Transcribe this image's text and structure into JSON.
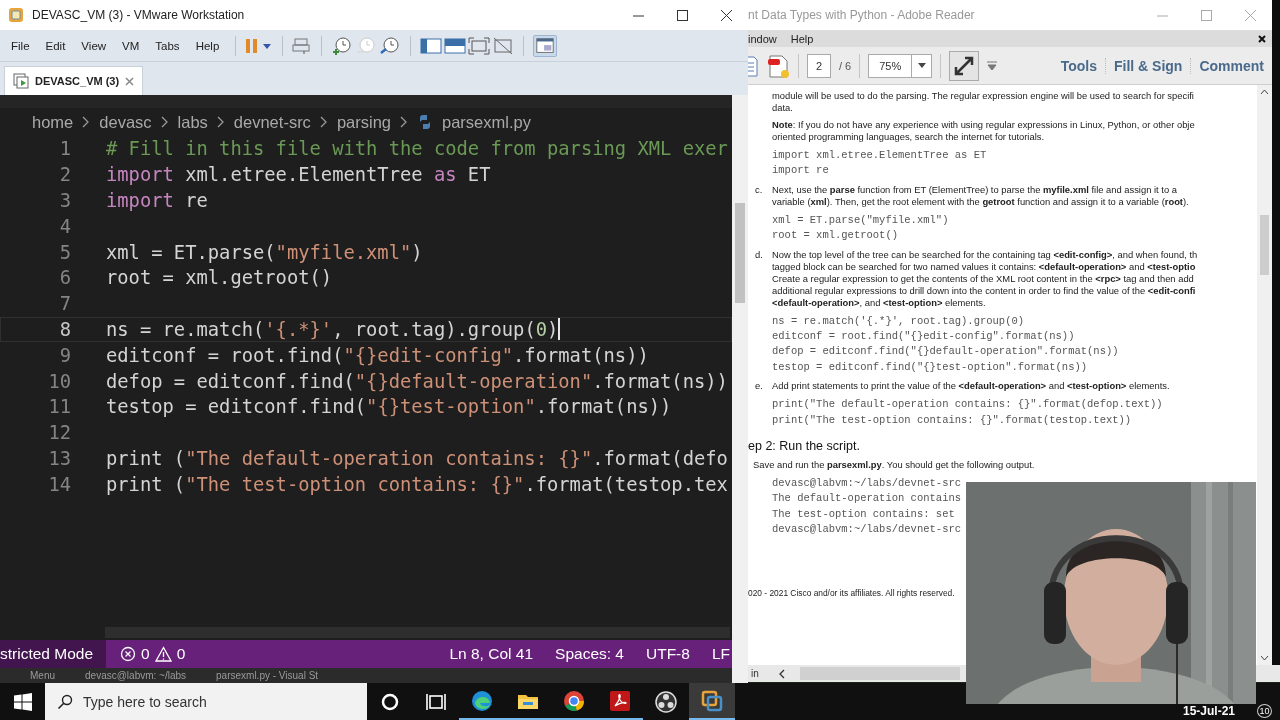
{
  "vmware": {
    "title": "DEVASC_VM (3) - VMware Workstation",
    "menu": [
      "File",
      "Edit",
      "View",
      "VM",
      "Tabs",
      "Help"
    ],
    "tabs": [
      {
        "label": "DEVASC_VM (3)",
        "selected": true
      }
    ],
    "editor": {
      "breadcrumbs": [
        "home",
        "devasc",
        "labs",
        "devnet-src",
        "parsing",
        "parsexml.py"
      ],
      "lines": [
        {
          "number": "1",
          "current": false,
          "tokens": [
            {
              "kind": "comment",
              "text": "# Fill in this file with the code from parsing XML exer"
            }
          ]
        },
        {
          "number": "2",
          "current": false,
          "tokens": [
            {
              "kind": "keyword",
              "text": "import"
            },
            {
              "kind": "plain",
              "text": " xml.etree.ElementTree "
            },
            {
              "kind": "keyword",
              "text": "as"
            },
            {
              "kind": "plain",
              "text": " ET"
            }
          ]
        },
        {
          "number": "3",
          "current": false,
          "tokens": [
            {
              "kind": "keyword",
              "text": "import"
            },
            {
              "kind": "plain",
              "text": " re"
            }
          ]
        },
        {
          "number": "4",
          "current": false
        },
        {
          "number": "5",
          "current": false,
          "tokens": [
            {
              "kind": "plain",
              "text": "xml = ET.parse("
            },
            {
              "kind": "string",
              "text": "\"myfile.xml\""
            },
            {
              "kind": "plain",
              "text": ")"
            }
          ]
        },
        {
          "number": "6",
          "current": false,
          "tokens": [
            {
              "kind": "plain",
              "text": "root = xml.getroot()"
            }
          ]
        },
        {
          "number": "7",
          "current": false
        },
        {
          "number": "8",
          "current": true,
          "tokens": [
            {
              "kind": "plain",
              "text": "ns = re.match("
            },
            {
              "kind": "string",
              "text": "'{.*}'"
            },
            {
              "kind": "plain",
              "text": ", root.tag).group("
            },
            {
              "kind": "number",
              "text": "0"
            },
            {
              "kind": "plain",
              "text": ")"
            }
          ]
        },
        {
          "number": "9",
          "current": false,
          "tokens": [
            {
              "kind": "plain",
              "text": "editconf = root.find("
            },
            {
              "kind": "string",
              "text": "\"{}edit-config\""
            },
            {
              "kind": "plain",
              "text": ".format(ns))"
            }
          ]
        },
        {
          "number": "10",
          "current": false,
          "tokens": [
            {
              "kind": "plain",
              "text": "defop = editconf.find("
            },
            {
              "kind": "string",
              "text": "\"{}default-operation\""
            },
            {
              "kind": "plain",
              "text": ".format(ns))"
            }
          ]
        },
        {
          "number": "11",
          "current": false,
          "tokens": [
            {
              "kind": "plain",
              "text": "testop = editconf.find("
            },
            {
              "kind": "string",
              "text": "\"{}test-option\""
            },
            {
              "kind": "plain",
              "text": ".format(ns))"
            }
          ]
        },
        {
          "number": "12",
          "current": false
        },
        {
          "number": "13",
          "current": false,
          "tokens": [
            {
              "kind": "plain",
              "text": "print ("
            },
            {
              "kind": "string",
              "text": "\"The default-operation contains: {}\""
            },
            {
              "kind": "plain",
              "text": ".format(defo"
            }
          ]
        },
        {
          "number": "14",
          "current": false,
          "tokens": [
            {
              "kind": "plain",
              "text": "print ("
            },
            {
              "kind": "string",
              "text": "\"The test-option contains: {}\""
            },
            {
              "kind": "plain",
              "text": ".format(testop.tex"
            }
          ]
        }
      ]
    },
    "status_bar": {
      "mode": "stricted Mode",
      "errors": "0",
      "warnings": "0",
      "items": [
        "Ln 8, Col 41",
        "Spaces: 4",
        "UTF-8",
        "LF"
      ]
    },
    "guest_taskbar": [
      "Menu",
      "devasc@labvm: ~/labs",
      "parsexml.py - Visual St"
    ]
  },
  "reader": {
    "title": "nt Data Types with Python - Adobe Reader",
    "menu": [
      "indow",
      "Help"
    ],
    "page": "2",
    "page_total": "/ 6",
    "zoom": "75%",
    "buttons": [
      "Tools",
      "Fill & Sign",
      "Comment"
    ],
    "blocks": [
      {
        "kind": "text",
        "text": "module will be used to do the parsing. The regular expression engine will be used to search for specifi\ndata."
      },
      {
        "kind": "text",
        "text": "**Note**: If you do not have any experience with using regular expressions in Linux, Python, or other obje\noriented programming languages, search the internet for tutorials."
      },
      {
        "kind": "code",
        "text": "import xml.etree.ElementTree as ET\nimport re"
      },
      {
        "kind": "text",
        "marker": "c.",
        "text": "Next, use the **parse** function from ET (ElementTree) to parse the **myfile.xml** file and assign it to a\nvariable (**xml**). Then, get the root element with the **getroot** function and assign it to a variable (**root**)."
      },
      {
        "kind": "code",
        "text": "xml = ET.parse(\"myfile.xml\")\nroot = xml.getroot()"
      },
      {
        "kind": "text",
        "marker": "d.",
        "text": "Now the top level of the tree can be searched for the containing tag **<edit-config>**, and when found, th\ntagged block can be searched for two named values it contains: **<default-operation>** and **<test-optio**\nCreate a regular expression to get the contents of the XML root content in the **<rpc>** tag and then add\nadditional regular expressions to drill down into the content in order to find the value of the **<edit-confi**\n**<default-operation>**, and **<test-option>** elements."
      },
      {
        "kind": "code",
        "text": "ns = re.match('{.*}', root.tag).group(0)\neditconf = root.find(\"{}edit-config\".format(ns))\ndefop = editconf.find(\"{}default-operation\".format(ns))\ntestop = editconf.find(\"{}test-option\".format(ns))"
      },
      {
        "kind": "text",
        "marker": "e.",
        "text": "Add print statements to print the value of the **<default-operation>** and **<test-option>** elements."
      },
      {
        "kind": "code",
        "text": "print(\"The default-operation contains: {}\".format(defop.text))\nprint(\"The test-option contains: {}\".format(testop.text))"
      },
      {
        "kind": "heading",
        "text": "ep 2: Run the script."
      },
      {
        "kind": "lead",
        "text": "Save and run the **parsexml.py**. You should get the following output."
      },
      {
        "kind": "code",
        "text": "devasc@labvm:~/labs/devnet-src\nThe default-operation contains\nThe test-option contains: set\ndevasc@labvm:~/labs/devnet-src"
      },
      {
        "kind": "footer",
        "text": "020 - 2021 Cisco and/or its affiliates. All rights reserved."
      }
    ],
    "status": "in"
  },
  "taskbar": {
    "search_placeholder": "Type here to search",
    "apps": [
      {
        "kind": "cortana",
        "running": false,
        "selected": false
      },
      {
        "kind": "taskview",
        "running": false,
        "selected": false
      },
      {
        "kind": "edge",
        "running": true,
        "selected": false
      },
      {
        "kind": "folder",
        "running": true,
        "selected": false
      },
      {
        "kind": "chrome",
        "running": true,
        "selected": false
      },
      {
        "kind": "acrobat",
        "running": true,
        "selected": false
      },
      {
        "kind": "obs",
        "running": false,
        "selected": false
      },
      {
        "kind": "vmware",
        "running": true,
        "selected": true
      }
    ],
    "date": "15-Jul-21",
    "notifications": "10"
  }
}
